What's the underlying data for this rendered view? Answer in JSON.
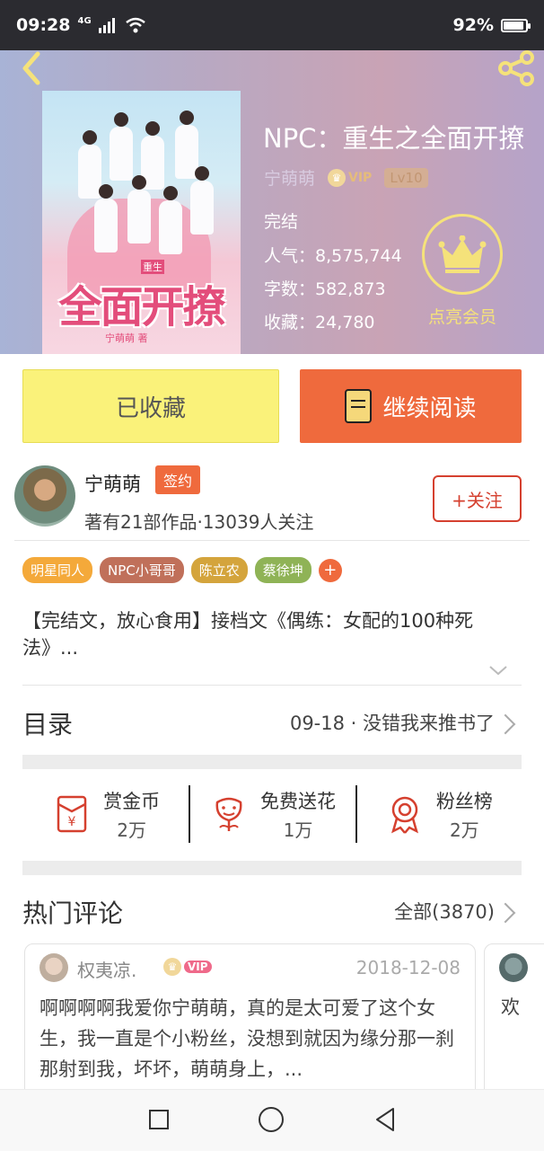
{
  "status_bar": {
    "time": "09:28",
    "network": "4G",
    "battery": "92%",
    "battery_level": 0.92
  },
  "book": {
    "title": "NPC：重生之全面开撩",
    "cover_title": "全面开撩",
    "cover_tag": "重生",
    "cover_sub": "宁萌萌 著",
    "author": "宁萌萌",
    "vip_label": "VIP",
    "level": "Lv10",
    "status": "完结",
    "stats": [
      {
        "label": "人气：",
        "value": "8,575,744"
      },
      {
        "label": "字数：",
        "value": "582,873"
      },
      {
        "label": "收藏：",
        "value": "24,780"
      }
    ],
    "member_label": "点亮会员"
  },
  "buttons": {
    "collect": "已收藏",
    "read": "继续阅读",
    "follow": "+关注"
  },
  "author_section": {
    "name": "宁萌萌",
    "signed": "签约",
    "info": "著有21部作品·13039人关注"
  },
  "tags": [
    {
      "label": "明星同人",
      "color": "#f4a93a"
    },
    {
      "label": "NPC小哥哥",
      "color": "#c0705a"
    },
    {
      "label": "陈立农",
      "color": "#d4a43c"
    },
    {
      "label": "蔡徐坤",
      "color": "#8fb356"
    }
  ],
  "tag_more": "+",
  "intro": "【完结文，放心食用】接档文《偶练：女配的100种死法》...",
  "toc": {
    "title": "目录",
    "latest": "09-18 · 没错我来推书了"
  },
  "actions": [
    {
      "label": "赏金币",
      "count": "2万",
      "icon": "red-envelope-icon"
    },
    {
      "label": "免费送花",
      "count": "1万",
      "icon": "flower-icon"
    },
    {
      "label": "粉丝榜",
      "count": "2万",
      "icon": "medal-icon"
    }
  ],
  "hot_comments": {
    "title": "热门评论",
    "all": "全部(3870)",
    "items": [
      {
        "user": "权夷凉.",
        "vip": "VIP",
        "date": "2018-12-08",
        "text": "啊啊啊啊我爱你宁萌萌，真的是太可爱了这个女生，我一直是个小粉丝，没想到就因为缘分那一刹那射到我，坏坏，萌萌身上，..."
      },
      {
        "text": "欢"
      }
    ]
  },
  "colors": {
    "accent": "#ef6a3d",
    "collect_bg": "#faf27a",
    "member_gold": "#f5e27a",
    "follow_red": "#d5402f"
  }
}
